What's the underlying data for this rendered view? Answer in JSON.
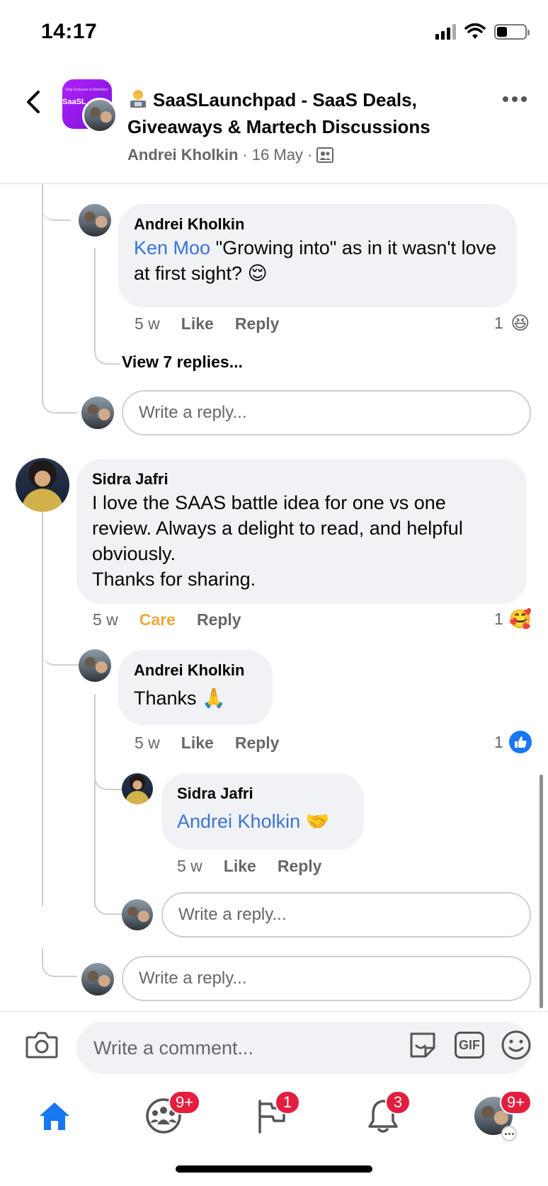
{
  "status_bar": {
    "time": "14:17"
  },
  "header": {
    "group_title": "SaaSLaunchpad - SaaS Deals, Giveaways & Martech Discussions",
    "group_avatar_text": "SaaSL",
    "group_avatar_sub": "Only Exclusive to Members",
    "author": "Andrei Kholkin",
    "separator": "·",
    "date": "16 May"
  },
  "comments": {
    "reply1": {
      "name": "Andrei Kholkin",
      "mention": "Ken Moo",
      "text": " \"Growing into\" as in it wasn't love at first sight? 😌",
      "time": "5 w",
      "like": "Like",
      "reply": "Reply",
      "reaction_count": "1",
      "reaction_emoji": "😆"
    },
    "view_replies": "View 7 replies...",
    "reply_input_1": "Write a reply...",
    "main2": {
      "name": "Sidra Jafri",
      "text": "I love the SAAS battle idea for one vs one\nreview. Always a delight to read, and helpful\nobviously.\nThanks for sharing.",
      "time": "5 w",
      "care": "Care",
      "reply": "Reply",
      "reaction_count": "1",
      "reaction_emoji": "🥰"
    },
    "reply2": {
      "name": "Andrei Kholkin",
      "text": "Thanks 🙏",
      "time": "5 w",
      "like": "Like",
      "reply": "Reply",
      "reaction_count": "1",
      "reaction_emoji": "👍"
    },
    "reply3": {
      "name": "Sidra Jafri",
      "mention": "Andrei Kholkin",
      "emoji": "🤝",
      "time": "5 w",
      "like": "Like",
      "reply": "Reply"
    },
    "reply_input_2": "Write a reply...",
    "reply_input_3": "Write a reply..."
  },
  "composer": {
    "placeholder": "Write a comment...",
    "gif_label": "GIF"
  },
  "tabbar": {
    "groups_badge": "9+",
    "pages_badge": "1",
    "notifications_badge": "3",
    "profile_badge": "9+"
  },
  "colors": {
    "accent": "#1877f2",
    "badge": "#e41e3f",
    "care": "#f0a63a",
    "mention": "#3b74d4"
  }
}
